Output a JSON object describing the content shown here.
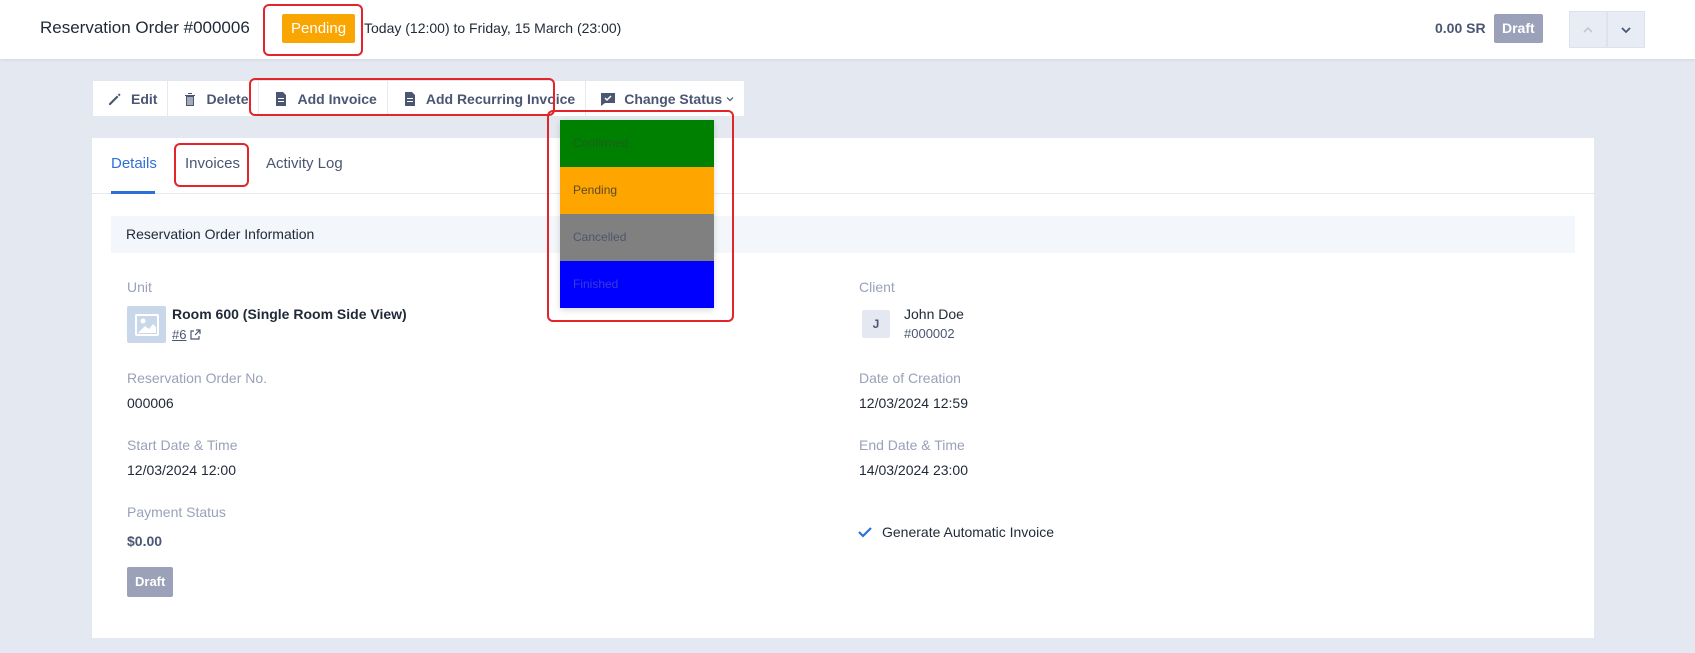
{
  "header": {
    "title": "Reservation Order #000006",
    "status": "Pending",
    "status_color": "#f9a602",
    "date_range": "Today (12:00) to Friday, 15 March (23:00)",
    "total": "0.00 SR",
    "draft": "Draft",
    "nav_prev_icon": "chevron-up-icon",
    "nav_next_icon": "chevron-down-icon"
  },
  "toolbar": {
    "edit": "Edit",
    "delete": "Delete",
    "add_invoice": "Add Invoice",
    "add_recurring_invoice": "Add Recurring Invoice",
    "change_status": "Change Status"
  },
  "status_menu": {
    "items": [
      {
        "label": "Confirmed",
        "color": "#008000"
      },
      {
        "label": "Pending",
        "color": "#ffa500"
      },
      {
        "label": "Cancelled",
        "color": "#808080"
      },
      {
        "label": "Finished",
        "color": "#0000ff"
      }
    ]
  },
  "tabs": [
    "Details",
    "Invoices",
    "Activity Log"
  ],
  "section": {
    "title": "Reservation Order Information"
  },
  "details": {
    "unit_label": "Unit",
    "unit_name": "Room 600 (Single Room Side View)",
    "unit_link": "#6",
    "client_label": "Client",
    "client_initial": "J",
    "client_name": "John Doe",
    "client_code": "#000002",
    "order_no_label": "Reservation Order No.",
    "order_no": "000006",
    "created_label": "Date of Creation",
    "created": "12/03/2024 12:59",
    "start_label": "Start Date & Time",
    "start": "12/03/2024 12:00",
    "end_label": "End Date & Time",
    "end": "14/03/2024 23:00",
    "payment_label": "Payment Status",
    "payment_amount": "$0.00",
    "payment_badge": "Draft",
    "auto_invoice": "Generate Automatic Invoice"
  }
}
